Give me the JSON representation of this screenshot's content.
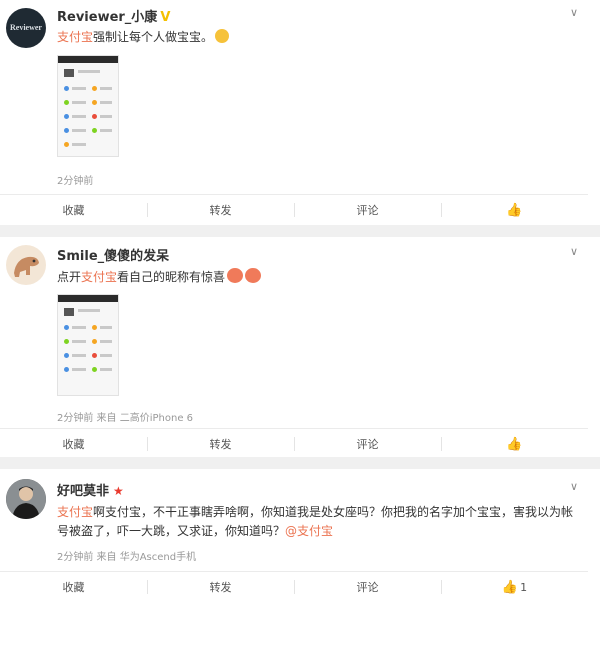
{
  "posts": [
    {
      "username": "Reviewer_小康",
      "avatar_text": "Reviewer",
      "content_link": "支付宝",
      "content_rest": "强制让每个人做宝宝。",
      "meta": "2分钟前",
      "actions": [
        "收藏",
        "转发",
        "评论",
        ""
      ],
      "emoji": [
        "laughing-emoji"
      ]
    },
    {
      "username": "Smile_傻傻的发呆",
      "content_prefix": "点开",
      "content_link": "支付宝",
      "content_rest": "看自己的昵称有惊喜",
      "meta": "2分钟前 来自 二高价iPhone 6",
      "actions": [
        "收藏",
        "转发",
        "评论",
        ""
      ],
      "emoji": [
        "red-face-emoji",
        "red-face-emoji"
      ]
    },
    {
      "username": "好吧莫非",
      "content_link": "支付宝",
      "content_line1": "啊支付宝，不干正事瞎弄啥啊，你知道我是处女座吗？你把我的名字加个宝宝，害我以为帐",
      "content_line2": "号被盗了，吓一大跳，又求证，你知道吗？",
      "mention": "@支付宝",
      "meta": "2分钟前 来自 华为Ascend手机",
      "actions": [
        "收藏",
        "转发",
        "评论",
        "1"
      ]
    }
  ],
  "colors": {
    "link": "#eb7350",
    "meta": "#999999",
    "separator": "#f0f0f0",
    "verified_badge": "#f4c000",
    "star_badge": "#e93a2e"
  },
  "icons": {
    "chevron": "chevron-down-icon",
    "like": "thumbs-up-icon",
    "verified": "verified-v-icon",
    "star": "star-badge-icon"
  }
}
